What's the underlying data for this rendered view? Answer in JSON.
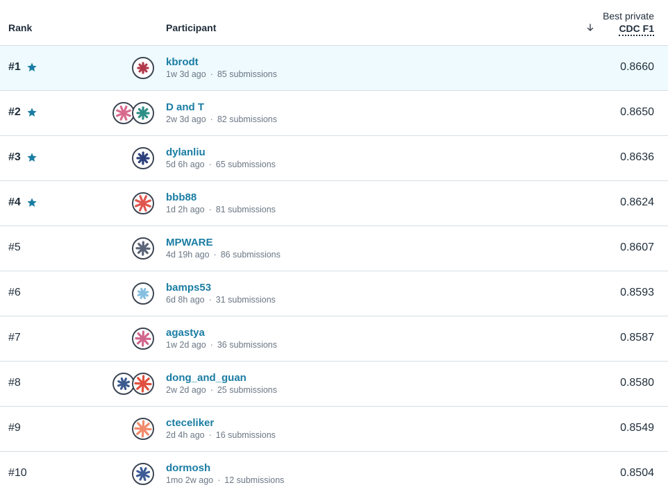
{
  "header": {
    "rank_label": "Rank",
    "participant_label": "Participant",
    "score_label_top": "Best private",
    "score_label_metric": "CDC F1"
  },
  "colors": {
    "accent": "#1a7da3",
    "highlight_row": "#eefafd",
    "star": "#1a7da3"
  },
  "rows": [
    {
      "rank": "#1",
      "starred": true,
      "name": "kbrodt",
      "time": "1w 3d ago",
      "submissions": "85 submissions",
      "score": "0.8660",
      "avatars": [
        "#b0384a"
      ]
    },
    {
      "rank": "#2",
      "starred": true,
      "name": "D and T",
      "time": "2w 3d ago",
      "submissions": "82 submissions",
      "score": "0.8650",
      "avatars": [
        "#d86a8e",
        "#2f8f86"
      ]
    },
    {
      "rank": "#3",
      "starred": true,
      "name": "dylanliu",
      "time": "5d 6h ago",
      "submissions": "65 submissions",
      "score": "0.8636",
      "avatars": [
        "#2b3f7a"
      ]
    },
    {
      "rank": "#4",
      "starred": true,
      "name": "bbb88",
      "time": "1d 2h ago",
      "submissions": "81 submissions",
      "score": "0.8624",
      "avatars": [
        "#e0564e"
      ]
    },
    {
      "rank": "#5",
      "starred": false,
      "name": "MPWARE",
      "time": "4d 19h ago",
      "submissions": "86 submissions",
      "score": "0.8607",
      "avatars": [
        "#5a6478"
      ]
    },
    {
      "rank": "#6",
      "starred": false,
      "name": "bamps53",
      "time": "6d 8h ago",
      "submissions": "31 submissions",
      "score": "0.8593",
      "avatars": [
        "#86bfe0"
      ]
    },
    {
      "rank": "#7",
      "starred": false,
      "name": "agastya",
      "time": "1w 2d ago",
      "submissions": "36 submissions",
      "score": "0.8587",
      "avatars": [
        "#d0668c"
      ]
    },
    {
      "rank": "#8",
      "starred": false,
      "name": "dong_and_guan",
      "time": "2w 2d ago",
      "submissions": "25 submissions",
      "score": "0.8580",
      "avatars": [
        "#3b5b8f",
        "#e04f3f"
      ]
    },
    {
      "rank": "#9",
      "starred": false,
      "name": "cteceliker",
      "time": "2d 4h ago",
      "submissions": "16 submissions",
      "score": "0.8549",
      "avatars": [
        "#f08a6a"
      ]
    },
    {
      "rank": "#10",
      "starred": false,
      "name": "dormosh",
      "time": "1mo 2w ago",
      "submissions": "12 submissions",
      "score": "0.8504",
      "avatars": [
        "#3d5b96"
      ]
    }
  ]
}
